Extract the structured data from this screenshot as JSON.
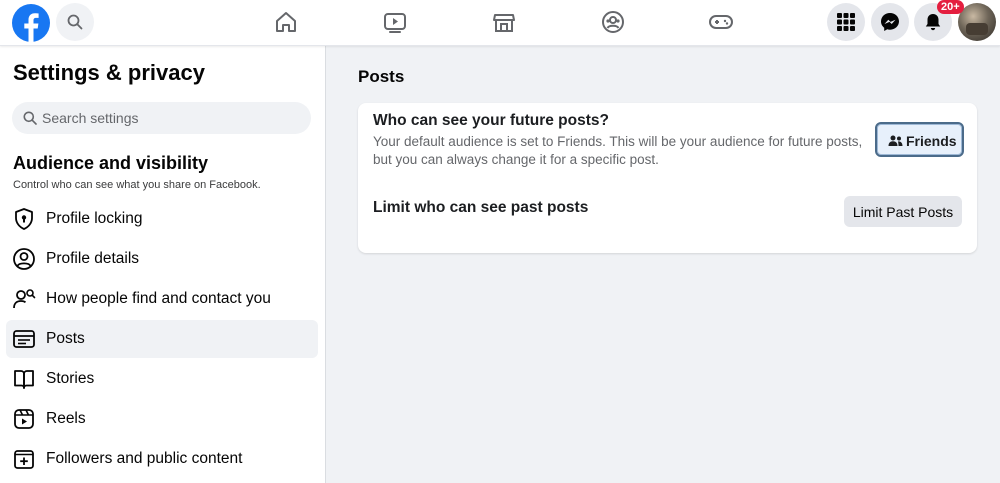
{
  "topbar": {
    "notification_badge": "20+",
    "icons": [
      "facebook-logo",
      "search-icon",
      "home-icon",
      "watch-icon",
      "marketplace-icon",
      "groups-icon",
      "gaming-icon",
      "menu-grid-icon",
      "messenger-icon",
      "bell-icon",
      "profile-avatar"
    ],
    "brand_color": "#1877f2"
  },
  "sidebar": {
    "title": "Settings & privacy",
    "search_placeholder": "Search settings",
    "section_title": "Audience and visibility",
    "section_subtitle": "Control who can see what you share on Facebook.",
    "items": [
      {
        "label": "Profile locking",
        "icon": "shield-lock-icon"
      },
      {
        "label": "Profile details",
        "icon": "person-circle-icon"
      },
      {
        "label": "How people find and contact you",
        "icon": "person-search-icon"
      },
      {
        "label": "Posts",
        "icon": "posts-icon",
        "active": true
      },
      {
        "label": "Stories",
        "icon": "book-icon"
      },
      {
        "label": "Reels",
        "icon": "reels-icon"
      },
      {
        "label": "Followers and public content",
        "icon": "add-square-icon"
      }
    ]
  },
  "main": {
    "title": "Posts",
    "future_posts": {
      "heading": "Who can see your future posts?",
      "description": "Your default audience is set to Friends. This will be your audience for future posts, but you can always change it for a specific post.",
      "button_label": "Friends"
    },
    "past_posts": {
      "heading": "Limit who can see past posts",
      "button_label": "Limit Past Posts"
    }
  }
}
